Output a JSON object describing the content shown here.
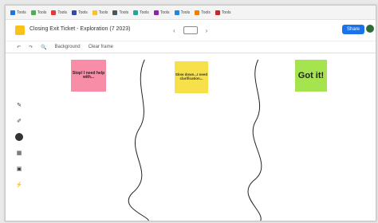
{
  "bookmarks": [
    {
      "label": "Tools",
      "color": "#1a73e8"
    },
    {
      "label": "Tools",
      "color": "#4caf50"
    },
    {
      "label": "Tools",
      "color": "#e53935"
    },
    {
      "label": "Tools",
      "color": "#3949ab"
    },
    {
      "label": "Tools",
      "color": "#fbc02d"
    },
    {
      "label": "Tools",
      "color": "#455a64"
    },
    {
      "label": "Tools",
      "color": "#26a69a"
    },
    {
      "label": "Tools",
      "color": "#8e24aa"
    },
    {
      "label": "Tools",
      "color": "#1e88e5"
    },
    {
      "label": "Tools",
      "color": "#f57c00"
    },
    {
      "label": "Tools",
      "color": "#c62828"
    }
  ],
  "header": {
    "title": "Closing Exit Ticket - Exploration (7 2023)",
    "nav_prev": "‹",
    "nav_next": "›",
    "share_label": "Share"
  },
  "toolbar": {
    "background_label": "Background",
    "clear_label": "Clear frame"
  },
  "notes": {
    "stop_text": "Stop! I need help with...",
    "see_text": "Slow down...I need clarification...",
    "got_text": "Got it!"
  },
  "colors": {
    "stop": "#f78da7",
    "see": "#f7e14b",
    "got": "#a5e44f",
    "share": "#1a73e8"
  },
  "icons": [
    "pen-icon",
    "marker-icon",
    "select-icon",
    "sticky-note-icon",
    "image-icon",
    "laser-icon"
  ]
}
